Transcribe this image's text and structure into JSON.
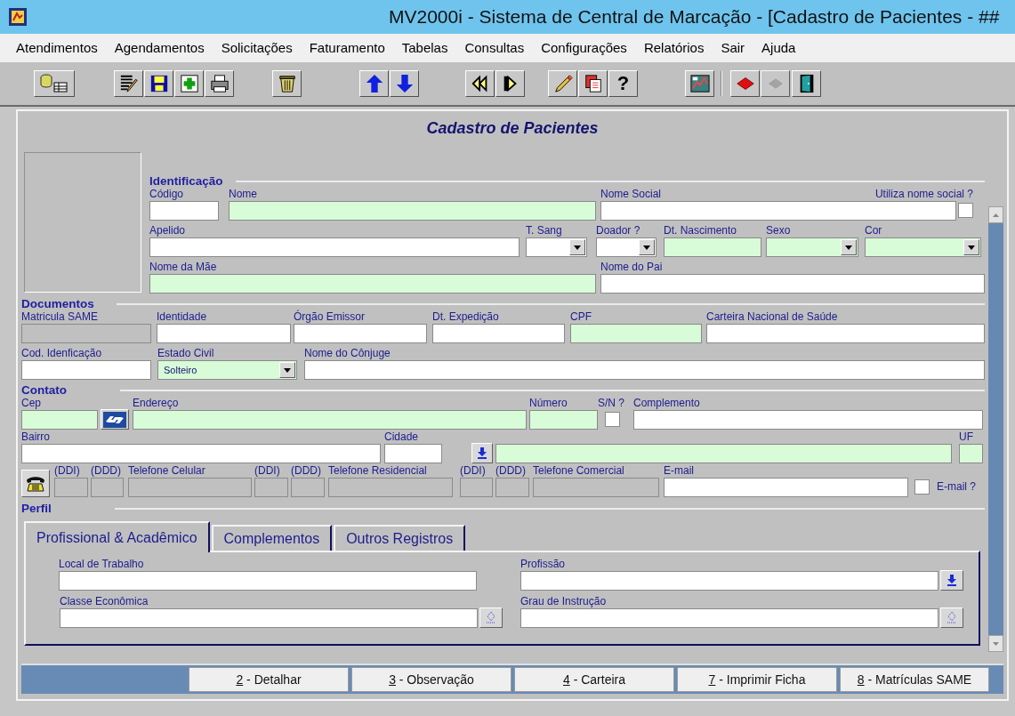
{
  "window": {
    "title": "MV2000i - Sistema de Central de Marcação - [Cadastro de Pacientes - ##"
  },
  "menu": [
    "Atendimentos",
    "Agendamentos",
    "Solicitações",
    "Faturamento",
    "Tabelas",
    "Consultas",
    "Configurações",
    "Relatórios",
    "Sair",
    "Ajuda"
  ],
  "toolbar": [
    [
      {
        "kind": "icon",
        "disabled": false
      }
    ],
    [
      {
        "kind": "icon",
        "disabled": false
      },
      {
        "kind": "icon",
        "disabled": false
      },
      {
        "kind": "icon",
        "disabled": false
      },
      {
        "kind": "icon",
        "disabled": false
      }
    ],
    [
      {
        "kind": "icon",
        "disabled": false
      }
    ],
    [
      {
        "kind": "icon",
        "disabled": false
      },
      {
        "kind": "icon",
        "disabled": false
      }
    ],
    [
      {
        "kind": "icon",
        "disabled": false
      },
      {
        "kind": "icon",
        "disabled": false
      }
    ],
    [
      {
        "kind": "icon",
        "disabled": false
      },
      {
        "kind": "icon",
        "disabled": false
      },
      {
        "kind": "text",
        "label": "?",
        "disabled": false
      }
    ],
    [
      {
        "kind": "icon",
        "disabled": false
      }
    ],
    [
      {
        "kind": "icon",
        "disabled": false
      },
      {
        "kind": "icon",
        "disabled": true
      }
    ],
    [
      {
        "kind": "icon",
        "disabled": false
      }
    ]
  ],
  "form": {
    "title": "Cadastro de Pacientes",
    "sections": [
      {
        "title": "Identificação",
        "rows": [
          {
            "fields": [
              {
                "kind": "text",
                "label": "Código",
                "required": false,
                "readonly": false
              },
              {
                "kind": "text",
                "label": "Nome",
                "required": true,
                "readonly": false
              },
              {
                "kind": "text",
                "label": "Nome Social",
                "required": false,
                "readonly": false
              },
              {
                "kind": "checkbox",
                "label": "Utiliza nome social ?",
                "checked": false
              }
            ]
          },
          {
            "fields": [
              {
                "kind": "text",
                "label": "Apelido",
                "required": false,
                "readonly": false
              },
              {
                "kind": "select",
                "label": "T. Sang",
                "required": false,
                "readonly": false
              },
              {
                "kind": "select",
                "label": "Doador ?",
                "required": false,
                "readonly": false
              },
              {
                "kind": "text",
                "label": "Dt. Nascimento",
                "required": true,
                "readonly": false
              },
              {
                "kind": "select",
                "label": "Sexo",
                "required": true,
                "readonly": false
              },
              {
                "kind": "select",
                "label": "Cor",
                "required": true,
                "readonly": false
              }
            ]
          },
          {
            "fields": [
              {
                "kind": "text",
                "label": "Nome da Mãe",
                "required": true,
                "readonly": false
              },
              {
                "kind": "text",
                "label": "Nome do Pai",
                "required": false,
                "readonly": false
              }
            ]
          }
        ]
      },
      {
        "title": "Documentos",
        "rows": [
          {
            "fields": [
              {
                "kind": "text",
                "label": "Matricula SAME",
                "required": false,
                "readonly": true
              },
              {
                "kind": "text",
                "label": "Identidade",
                "required": false,
                "readonly": false
              },
              {
                "kind": "text",
                "label": "Órgão Emissor",
                "required": false,
                "readonly": false
              },
              {
                "kind": "text",
                "label": "Dt. Expedição",
                "required": false,
                "readonly": false
              },
              {
                "kind": "text",
                "label": "CPF",
                "required": true,
                "readonly": false
              },
              {
                "kind": "text",
                "label": "Carteira Nacional de Saúde",
                "required": false,
                "readonly": false
              }
            ]
          },
          {
            "fields": [
              {
                "kind": "text",
                "label": "Cod. Idenficação",
                "required": false,
                "readonly": false
              },
              {
                "kind": "select",
                "label": "Estado Civil",
                "required": true,
                "readonly": false,
                "value": "Solteiro"
              },
              {
                "kind": "text",
                "label": "Nome do Cônjuge",
                "required": false,
                "readonly": false
              }
            ]
          }
        ]
      },
      {
        "title": "Contato",
        "rows": [
          {
            "fields": [
              {
                "kind": "text",
                "label": "Cep",
                "required": true,
                "readonly": false
              },
              {
                "kind": "cep-button"
              },
              {
                "kind": "text",
                "label": "Endereço",
                "required": true,
                "readonly": false
              },
              {
                "kind": "text",
                "label": "Número",
                "required": true,
                "readonly": false
              },
              {
                "kind": "checkbox",
                "label": "S/N ?",
                "checked": false
              },
              {
                "kind": "text",
                "label": "Complemento",
                "required": false,
                "readonly": false
              }
            ]
          },
          {
            "fields": [
              {
                "kind": "text",
                "label": "Bairro",
                "required": false,
                "readonly": false
              },
              {
                "kind": "text",
                "label": "Cidade",
                "required": false,
                "readonly": false
              },
              {
                "kind": "lookup-button"
              },
              {
                "kind": "text",
                "required": true,
                "readonly": false
              },
              {
                "kind": "text",
                "label": "UF",
                "required": true,
                "readonly": false
              }
            ]
          },
          {
            "fields": [
              {
                "kind": "phone-button"
              },
              {
                "kind": "text",
                "label": "(DDI)",
                "required": false,
                "readonly": true
              },
              {
                "kind": "text",
                "label": "(DDD)",
                "required": false,
                "readonly": true
              },
              {
                "kind": "text",
                "label": "Telefone Celular",
                "required": false,
                "readonly": true
              },
              {
                "kind": "text",
                "label": "(DDI)",
                "required": false,
                "readonly": true
              },
              {
                "kind": "text",
                "label": "(DDD)",
                "required": false,
                "readonly": true
              },
              {
                "kind": "text",
                "label": "Telefone Residencial",
                "required": false,
                "readonly": true
              },
              {
                "kind": "text",
                "label": "(DDI)",
                "required": false,
                "readonly": true
              },
              {
                "kind": "text",
                "label": "(DDD)",
                "required": false,
                "readonly": true
              },
              {
                "kind": "text",
                "label": "Telefone Comercial",
                "required": false,
                "readonly": true
              },
              {
                "kind": "text",
                "label": "E-mail",
                "required": false,
                "readonly": false
              },
              {
                "kind": "checkbox-inline",
                "label": "E-mail ?",
                "checked": false
              }
            ]
          }
        ]
      }
    ]
  },
  "profile": {
    "title": "Perfil",
    "tabs": [
      {
        "label": "Profissional & Acadêmico",
        "selected": true
      },
      {
        "label": "Complementos",
        "selected": false
      },
      {
        "label": "Outros Registros",
        "selected": false
      }
    ],
    "rows": [
      {
        "fields": [
          {
            "kind": "text",
            "label": "Local de Trabalho",
            "required": false,
            "readonly": false
          },
          {
            "kind": "text",
            "label": "Profissão",
            "required": false,
            "readonly": false
          },
          {
            "kind": "lookup-button"
          }
        ]
      },
      {
        "fields": [
          {
            "kind": "text",
            "label": "Classe Econômica",
            "required": false,
            "readonly": false
          },
          {
            "kind": "list-button"
          },
          {
            "kind": "text",
            "label": "Grau de Instrução",
            "required": false,
            "readonly": false
          },
          {
            "kind": "list-button"
          }
        ]
      }
    ]
  },
  "buttons": [
    {
      "mnemonic": "2",
      "label": "- Detalhar"
    },
    {
      "mnemonic": "3",
      "label": "- Observação"
    },
    {
      "mnemonic": "4",
      "label": "- Carteira"
    },
    {
      "mnemonic": "7",
      "label": "- Imprimir Ficha"
    },
    {
      "mnemonic": "8",
      "label": "- Matrículas SAME"
    }
  ]
}
